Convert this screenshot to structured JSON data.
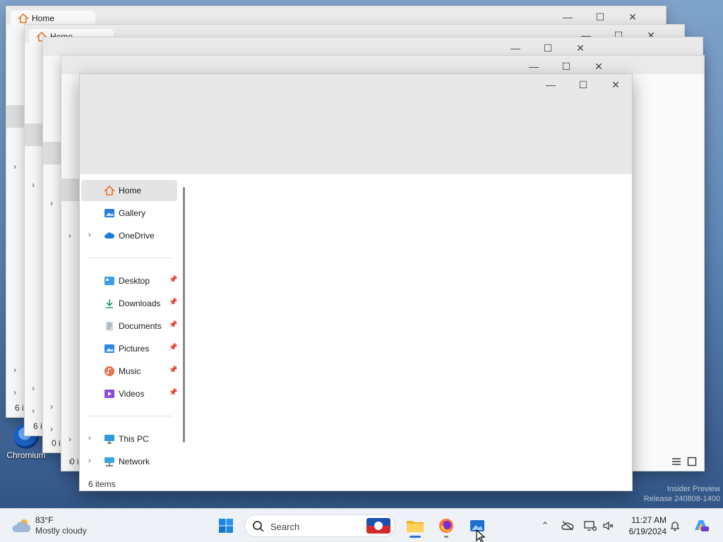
{
  "desktop": {
    "icon_label": "Chromium",
    "watermark_line1": "Insider Preview",
    "watermark_line2": "Release 240808-1400"
  },
  "ghost_windows": [
    {
      "tab_label": "Home",
      "status": "6 i"
    },
    {
      "tab_label": "Home",
      "status": "6 i"
    },
    {
      "tab_label": "",
      "status": "0 i"
    },
    {
      "tab_label": "",
      "status": "0 i"
    }
  ],
  "window": {
    "minimize": "—",
    "maximize": "☐",
    "close": "✕",
    "status": "6 items"
  },
  "nav": {
    "top": [
      {
        "label": "Home",
        "icon": "home-icon",
        "selected": true
      },
      {
        "label": "Gallery",
        "icon": "gallery-icon"
      },
      {
        "label": "OneDrive",
        "icon": "cloud-icon",
        "expandable": true
      }
    ],
    "quick": [
      {
        "label": "Desktop",
        "icon": "desktop-folder-icon"
      },
      {
        "label": "Downloads",
        "icon": "download-icon"
      },
      {
        "label": "Documents",
        "icon": "document-icon"
      },
      {
        "label": "Pictures",
        "icon": "pictures-icon"
      },
      {
        "label": "Music",
        "icon": "music-icon"
      },
      {
        "label": "Videos",
        "icon": "videos-icon"
      }
    ],
    "bottom": [
      {
        "label": "This PC",
        "icon": "monitor-icon"
      },
      {
        "label": "Network",
        "icon": "network-icon"
      }
    ]
  },
  "taskbar": {
    "weather_temp": "83°F",
    "weather_desc": "Mostly cloudy",
    "search_placeholder": "Search",
    "time": "11:27 AM",
    "date": "6/19/2024"
  },
  "colors": {
    "accent": "#2a6fd6",
    "home_icon": "#e8742a",
    "onedrive": "#1f7bd8"
  }
}
